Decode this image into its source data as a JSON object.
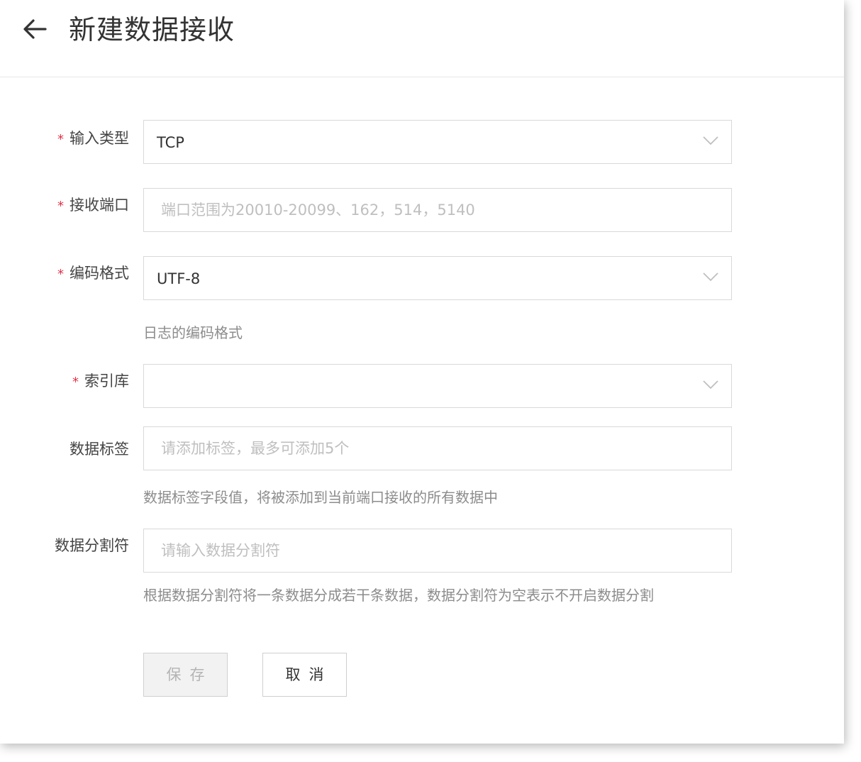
{
  "header": {
    "title": "新建数据接收"
  },
  "form": {
    "input_type": {
      "label": "输入类型",
      "required_mark": "*",
      "value": "TCP"
    },
    "port": {
      "label": "接收端口",
      "required_mark": "*",
      "placeholder": "端口范围为20010-20099、162，514，5140"
    },
    "encoding": {
      "label": "编码格式",
      "required_mark": "*",
      "value": "UTF-8",
      "hint": "日志的编码格式"
    },
    "index": {
      "label": "索引库",
      "required_mark": "*",
      "value": ""
    },
    "tags": {
      "label": "数据标签",
      "placeholder": "请添加标签，最多可添加5个",
      "hint": "数据标签字段值，将被添加到当前端口接收的所有数据中"
    },
    "delimiter": {
      "label": "数据分割符",
      "placeholder": "请输入数据分割符",
      "hint": "根据数据分割符将一条数据分成若干条数据，数据分割符为空表示不开启数据分割"
    }
  },
  "actions": {
    "save_label": "保存",
    "cancel_label": "取消"
  },
  "colors": {
    "required": "#e0334a",
    "border": "#d9d9d9",
    "placeholder": "#bfbfbf",
    "hint": "#8c8c8c"
  },
  "icons": {
    "back": "arrow-left-icon",
    "dropdown": "chevron-down-icon"
  }
}
